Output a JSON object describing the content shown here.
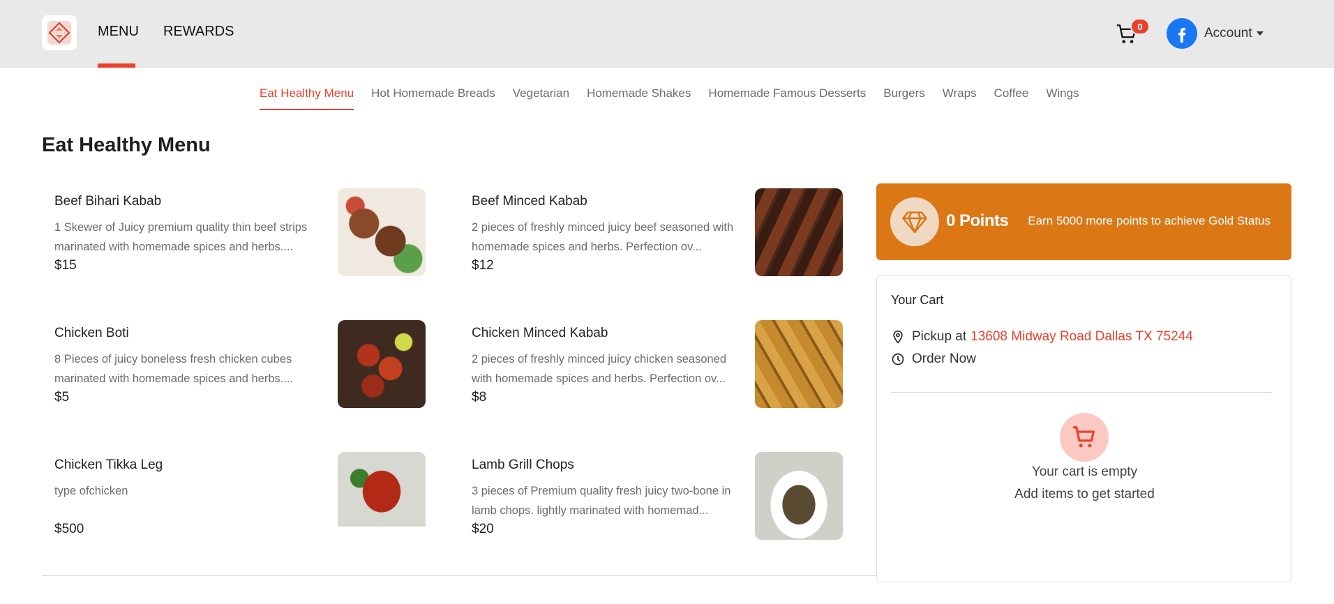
{
  "header": {
    "nav": [
      "MENU",
      "REWARDS"
    ],
    "active_nav": "MENU",
    "cart_count": "0",
    "account_label": "Account"
  },
  "categories": [
    "Eat Healthy Menu",
    "Hot Homemade Breads",
    "Vegetarian",
    "Homemade Shakes",
    "Homemade Famous Desserts",
    "Burgers",
    "Wraps",
    "Coffee",
    "Wings"
  ],
  "active_category": "Eat Healthy Menu",
  "section_title": "Eat Healthy Menu",
  "items": [
    {
      "name": "Beef Bihari Kabab",
      "desc": "1 Skewer of Juicy premium quality thin beef strips marinated with homemade spices and herbs....",
      "price": "$15"
    },
    {
      "name": "Beef Minced Kabab",
      "desc": "2 pieces of freshly minced juicy beef seasoned with homemade spices and herbs. Perfection ov...",
      "price": "$12"
    },
    {
      "name": "Chicken Boti",
      "desc": "8 Pieces of juicy boneless fresh chicken cubes marinated with homemade spices and herbs....",
      "price": "$5"
    },
    {
      "name": "Chicken Minced Kabab",
      "desc": "2 pieces of freshly minced juicy chicken seasoned with homemade spices and herbs. Perfection ov...",
      "price": "$8"
    },
    {
      "name": "Chicken Tikka Leg",
      "desc": "type ofchicken",
      "price": "$500"
    },
    {
      "name": "Lamb Grill Chops",
      "desc": "3 pieces of Premium quality fresh juicy two-bone in lamb chops. lightly marinated with homemad...",
      "price": "$20"
    }
  ],
  "points": {
    "value": "0 Points",
    "message": "Earn 5000 more points to achieve Gold Status"
  },
  "cart": {
    "title": "Your Cart",
    "pickup_label": "Pickup at",
    "pickup_address": "13608 Midway Road Dallas TX 75244",
    "order_label": "Order Now",
    "empty_title": "Your cart is empty",
    "empty_subtitle": "Add items to get started"
  },
  "colors": {
    "accent": "#e8412c",
    "points_bg": "#dc7716",
    "header_bg": "#e9e9e9"
  }
}
